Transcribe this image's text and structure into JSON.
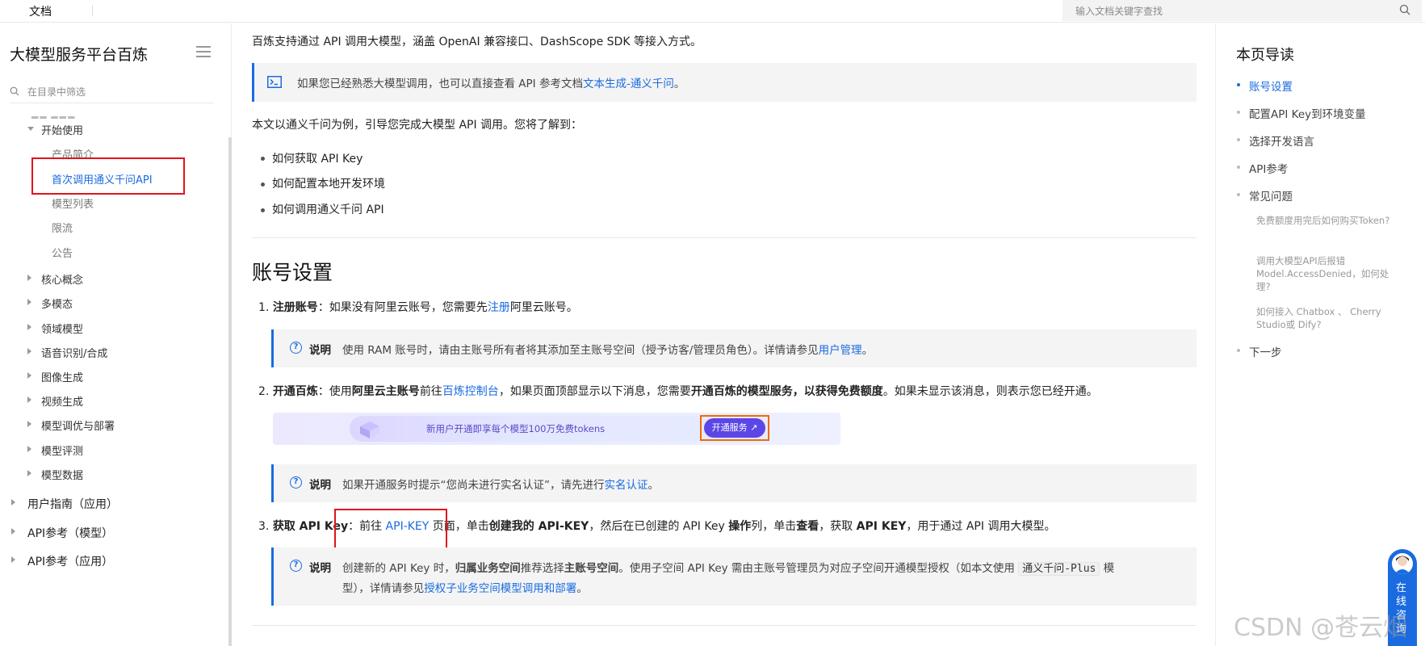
{
  "topbar": {
    "docs_label": "文档",
    "search_placeholder": "输入文档关键字查找"
  },
  "sidebar": {
    "title": "大模型服务平台百炼",
    "filter_placeholder": "在目录中筛选",
    "getting_started": "开始使用",
    "sub_items": [
      "产品简介",
      "首次调用通义千问API",
      "模型列表",
      "限流",
      "公告"
    ],
    "sections": [
      "核心概念",
      "多模态",
      "领域模型",
      "语音识别/合成",
      "图像生成",
      "视频生成",
      "模型调优与部署",
      "模型评测",
      "模型数据"
    ],
    "top_sections": [
      "用户指南（应用）",
      "API参考（模型）",
      "API参考（应用）"
    ]
  },
  "main": {
    "intro": "百炼支持通过 API 调用大模型，涵盖 OpenAI 兼容接口、DashScope SDK 等接入方式。",
    "tip1_text": "如果您已经熟悉大模型调用，也可以直接查看 API 参考文档",
    "tip1_link": "文本生成-通义千问",
    "tip1_end": "。",
    "lead": "本文以通义千问为例，引导您完成大模型 API 调用。您将了解到：",
    "bullets": [
      "如何获取 API Key",
      "如何配置本地开发环境",
      "如何调用通义千问 API"
    ],
    "heading": "账号设置",
    "step1": {
      "num": "1.",
      "label": "注册账号",
      "text_a": "：如果没有阿里云账号，您需要先",
      "link": "注册",
      "text_b": "阿里云账号。"
    },
    "note1": {
      "label": "说明",
      "text": "使用 RAM 账号时，请由主账号所有者将其添加至主账号空间（授予访客/管理员角色）。详情请参见",
      "link": "用户管理",
      "end": "。"
    },
    "step2": {
      "num": "2.",
      "label": "开通百炼",
      "t1": "：使用",
      "b1": "阿里云主账号",
      "t2": "前往",
      "link": "百炼控制台",
      "t3": "，如果页面顶部显示以下消息，您需要",
      "b2": "开通百炼的模型服务，以获得免费额度",
      "t4": "。如果未显示该消息，则表示您已经开通。"
    },
    "banner": {
      "text": "新用户开通即享每个模型100万免费tokens",
      "button": "开通服务 ↗"
    },
    "note2": {
      "label": "说明",
      "text": "如果开通服务时提示“您尚未进行实名认证”，请先进行",
      "link": "实名认证",
      "end": "。"
    },
    "step3": {
      "num": "3.",
      "label": "获取 API Key",
      "t1": "：前往 ",
      "link": "API-KEY",
      "t2": " 页面，单击",
      "b1": "创建我的 API-KEY",
      "t3": "，然后在已创建的 API Key ",
      "b2": "操作",
      "t4": "列，单击",
      "b3": "查看",
      "t5": "，获取 ",
      "b4": "API KEY",
      "t6": "，用于通过 API 调用大模型。"
    },
    "note3": {
      "label": "说明",
      "t1": "创建新的 API Key 时，",
      "b1": "归属业务空间",
      "t2": "推荐选择",
      "b2": "主账号空间",
      "t3": "。使用子空间 API Key 需由主账号管理员为对应子空间开通模型授权（如本文使用 ",
      "code": "通义千问-Plus",
      "t4": " 模",
      "line2": "型），详情请参见",
      "link": "授权子业务空间模型调用和部署",
      "end": "。"
    }
  },
  "toc": {
    "title": "本页导读",
    "items": [
      "账号设置",
      "配置API Key到环境变量",
      "选择开发语言",
      "API参考",
      "常见问题"
    ],
    "faq": [
      "免费额度用完后如何购买Token?",
      "调用大模型API后报错Model.AccessDenied，如何处理?",
      "如何接入 Chatbox 、 Cherry Studio或 Dify?"
    ],
    "last": "下一步"
  },
  "online": {
    "label": "在线咨询"
  },
  "watermark": "CSDN @苍云烟",
  "colors": {
    "link": "#1a6be0",
    "highlight_box": "#e0141e",
    "banner_button": "#5c46e6"
  }
}
